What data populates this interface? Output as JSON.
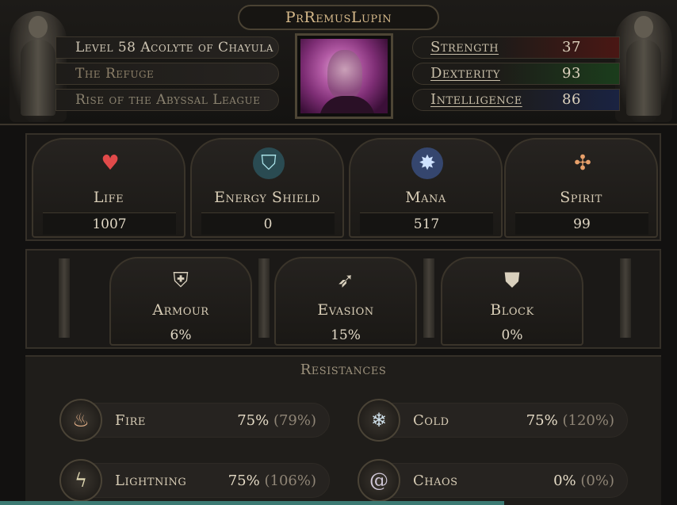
{
  "character": {
    "name": "PrRemusLupin",
    "level_line": "Level 58 Acolyte of Chayula",
    "area": "The Refuge",
    "league": "Rise of the Abyssal League"
  },
  "attributes": [
    {
      "name": "Strength",
      "value": "37",
      "color": "#7a1f1a"
    },
    {
      "name": "Dexterity",
      "value": "93",
      "color": "#2a5c2a"
    },
    {
      "name": "Intelligence",
      "value": "86",
      "color": "#2a3a6b"
    }
  ],
  "resources": {
    "life": {
      "label": "Life",
      "value": "1007",
      "icon": "heart-icon"
    },
    "energy_shield": {
      "label": "Energy Shield",
      "value": "0",
      "icon": "shield-crest-icon"
    },
    "mana": {
      "label": "Mana",
      "value": "517",
      "icon": "mana-star-icon"
    },
    "spirit": {
      "label": "Spirit",
      "value": "99",
      "icon": "spirit-orb-icon"
    }
  },
  "defences": {
    "armour": {
      "label": "Armour",
      "value": "6%",
      "icon": "armour-icon"
    },
    "evasion": {
      "label": "Evasion",
      "value": "15%",
      "icon": "evasion-icon"
    },
    "block": {
      "label": "Block",
      "value": "0%",
      "icon": "block-shield-icon"
    }
  },
  "resistances": {
    "title": "Resistances",
    "fire": {
      "label": "Fire",
      "value": "75%",
      "max": "(79%)",
      "icon": "fire-icon"
    },
    "cold": {
      "label": "Cold",
      "value": "75%",
      "max": "(120%)",
      "icon": "snowflake-icon"
    },
    "lightning": {
      "label": "Lightning",
      "value": "75%",
      "max": "(106%)",
      "icon": "lightning-icon"
    },
    "chaos": {
      "label": "Chaos",
      "value": "0%",
      "max": "(0%)",
      "icon": "chaos-spiral-icon"
    }
  }
}
